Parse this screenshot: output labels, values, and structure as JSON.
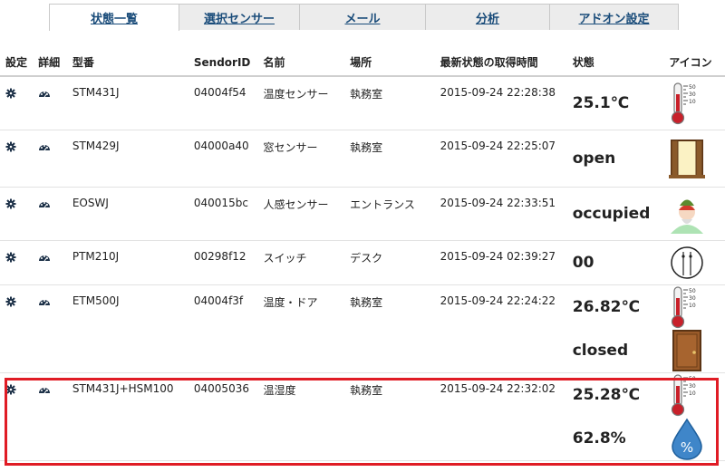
{
  "tabs": [
    "状態一覧",
    "選択センサー",
    "メール",
    "分析",
    "アドオン設定"
  ],
  "headers": [
    "設定",
    "詳細",
    "型番",
    "SendorID",
    "名前",
    "場所",
    "最新状態の取得時間",
    "状態",
    "アイコン"
  ],
  "rows": [
    {
      "model": "STM431J",
      "id": "04004f54",
      "name": "温度センサー",
      "place": "執務室",
      "time": "2015-09-24 22:28:38",
      "states": [
        {
          "value": "25.1℃",
          "icon": "thermometer-icon"
        }
      ]
    },
    {
      "model": "STM429J",
      "id": "04000a40",
      "name": "窓センサー",
      "place": "執務室",
      "time": "2015-09-24 22:25:07",
      "states": [
        {
          "value": "open",
          "icon": "open-window-icon"
        }
      ]
    },
    {
      "model": "EOSWJ",
      "id": "040015bc",
      "name": "人感センサー",
      "place": "エントランス",
      "time": "2015-09-24 22:33:51",
      "states": [
        {
          "value": "occupied",
          "icon": "person-icon"
        }
      ]
    },
    {
      "model": "PTM210J",
      "id": "00298f12",
      "name": "スイッチ",
      "place": "デスク",
      "time": "2015-09-24 02:39:27",
      "states": [
        {
          "value": "00",
          "icon": "switch-icon"
        }
      ]
    },
    {
      "model": "ETM500J",
      "id": "04004f3f",
      "name": "温度・ドア",
      "place": "執務室",
      "time": "2015-09-24 22:24:22",
      "states": [
        {
          "value": "26.82℃",
          "icon": "thermometer-icon"
        },
        {
          "value": "closed",
          "icon": "door-icon"
        }
      ]
    },
    {
      "model": "STM431J+HSM100",
      "id": "04005036",
      "name": "温湿度",
      "place": "執務室",
      "time": "2015-09-24 22:32:02",
      "states": [
        {
          "value": "25.28℃",
          "icon": "thermometer-icon"
        },
        {
          "value": "62.8%",
          "icon": "humidity-drop-icon"
        }
      ]
    }
  ],
  "thermo_ticks": [
    "50",
    "30",
    "10"
  ],
  "humidity_symbol": "%",
  "colors": {
    "highlight": "#e01c25",
    "tab_text": "#1a4c7a",
    "icon_gear": "#1d3148"
  }
}
